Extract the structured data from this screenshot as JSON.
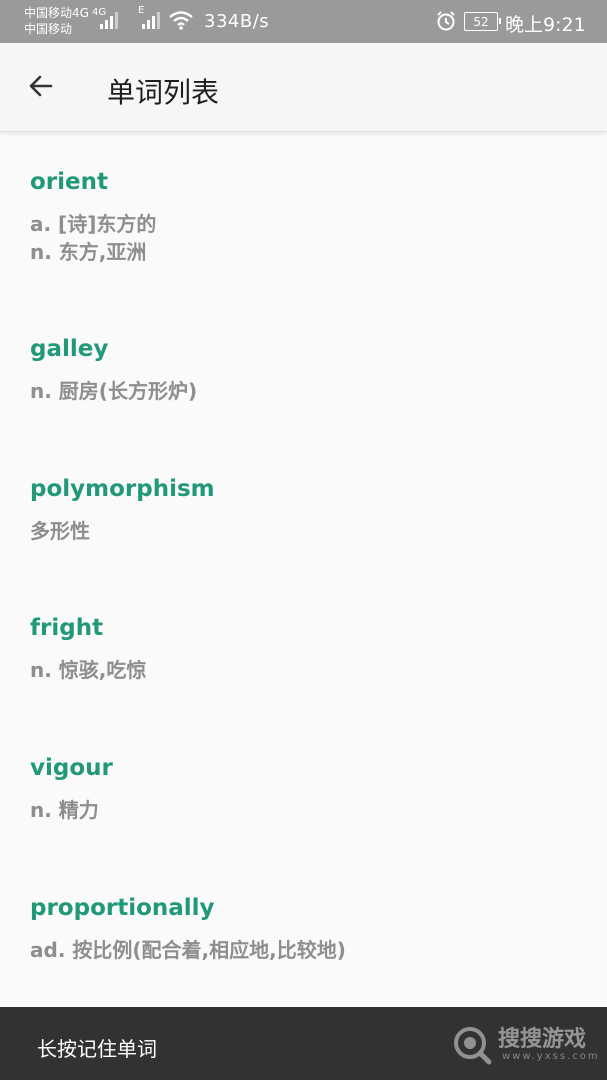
{
  "status_bar": {
    "carrier1": "中国移动4G",
    "network_badge": "4G",
    "carrier2": "中国移动",
    "signal2_badge": "E",
    "speed": "334B/s",
    "battery": "52",
    "time": "晚上9:21"
  },
  "app_bar": {
    "title": "单词列表"
  },
  "words": [
    {
      "word": "orient",
      "meaning": "a. [诗]东方的\nn. 东方,亚洲"
    },
    {
      "word": "galley",
      "meaning": "n. 厨房(长方形炉)"
    },
    {
      "word": "polymorphism",
      "meaning": "多形性"
    },
    {
      "word": "fright",
      "meaning": "n. 惊骇,吃惊"
    },
    {
      "word": "vigour",
      "meaning": "n. 精力"
    },
    {
      "word": "proportionally",
      "meaning": "ad. 按比例(配合着,相应地,比较地)"
    }
  ],
  "toast": {
    "text": "长按记住单词"
  },
  "watermark": {
    "brand": "搜搜游戏",
    "url": "www.yxss.com"
  },
  "colors": {
    "accent": "#22987a",
    "meaning": "#8e8e8e",
    "status_bar": "#9a9a9a",
    "toast_bg": "#323232"
  }
}
